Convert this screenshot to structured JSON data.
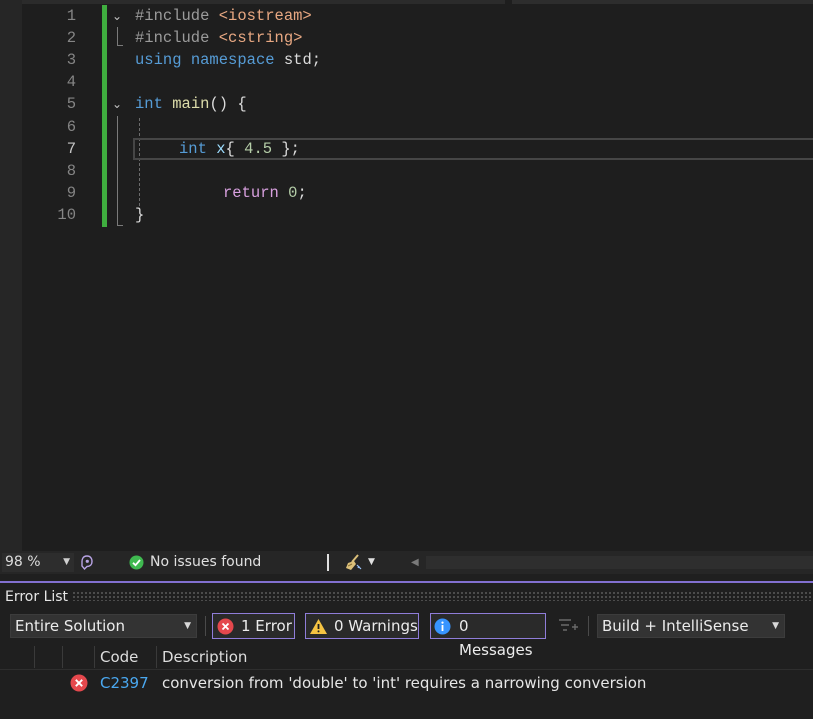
{
  "editor": {
    "line_numbers": [
      "1",
      "2",
      "3",
      "4",
      "5",
      "6",
      "7",
      "8",
      "9",
      "10"
    ],
    "active_line": "7",
    "lines": {
      "l1": {
        "pp": "#include ",
        "str": "<iostream>"
      },
      "l2": {
        "pp": "#include ",
        "str": "<cstring>"
      },
      "l3": {
        "kw1": "using",
        "kw2": "namespace",
        "rest": " std;"
      },
      "l5": {
        "kw": "int",
        "fn": "main",
        "rest": "() {"
      },
      "l7": {
        "kw": "int",
        "var": "x",
        "open": "{ ",
        "num": "4.5",
        "close": " };"
      },
      "l9": {
        "kw": "return",
        "num": "0",
        "rest": ";"
      },
      "l10": {
        "rest": "}"
      }
    },
    "fold_glyph": "⌄",
    "colors": {
      "change_bar": "#3fae3f",
      "keyword": "#569cd6",
      "control": "#d8a0df",
      "string": "#e8a882"
    }
  },
  "statusbar": {
    "zoom": "98 %",
    "status": "No issues found",
    "icons": [
      "intellicode-icon",
      "check-circle-icon",
      "cleanup-brush-icon"
    ]
  },
  "error_list": {
    "title": "Error List",
    "scope": "Entire Solution",
    "errors_filter": "1 Error",
    "warnings_filter": "0 Warnings",
    "messages_filter": "0 Messages",
    "source": "Build + IntelliSense",
    "columns": {
      "code": "Code",
      "description": "Description"
    },
    "rows": [
      {
        "code": "C2397",
        "description": "conversion from 'double' to 'int' requires a narrowing conversion"
      }
    ],
    "accent_color": "#8270d0"
  }
}
